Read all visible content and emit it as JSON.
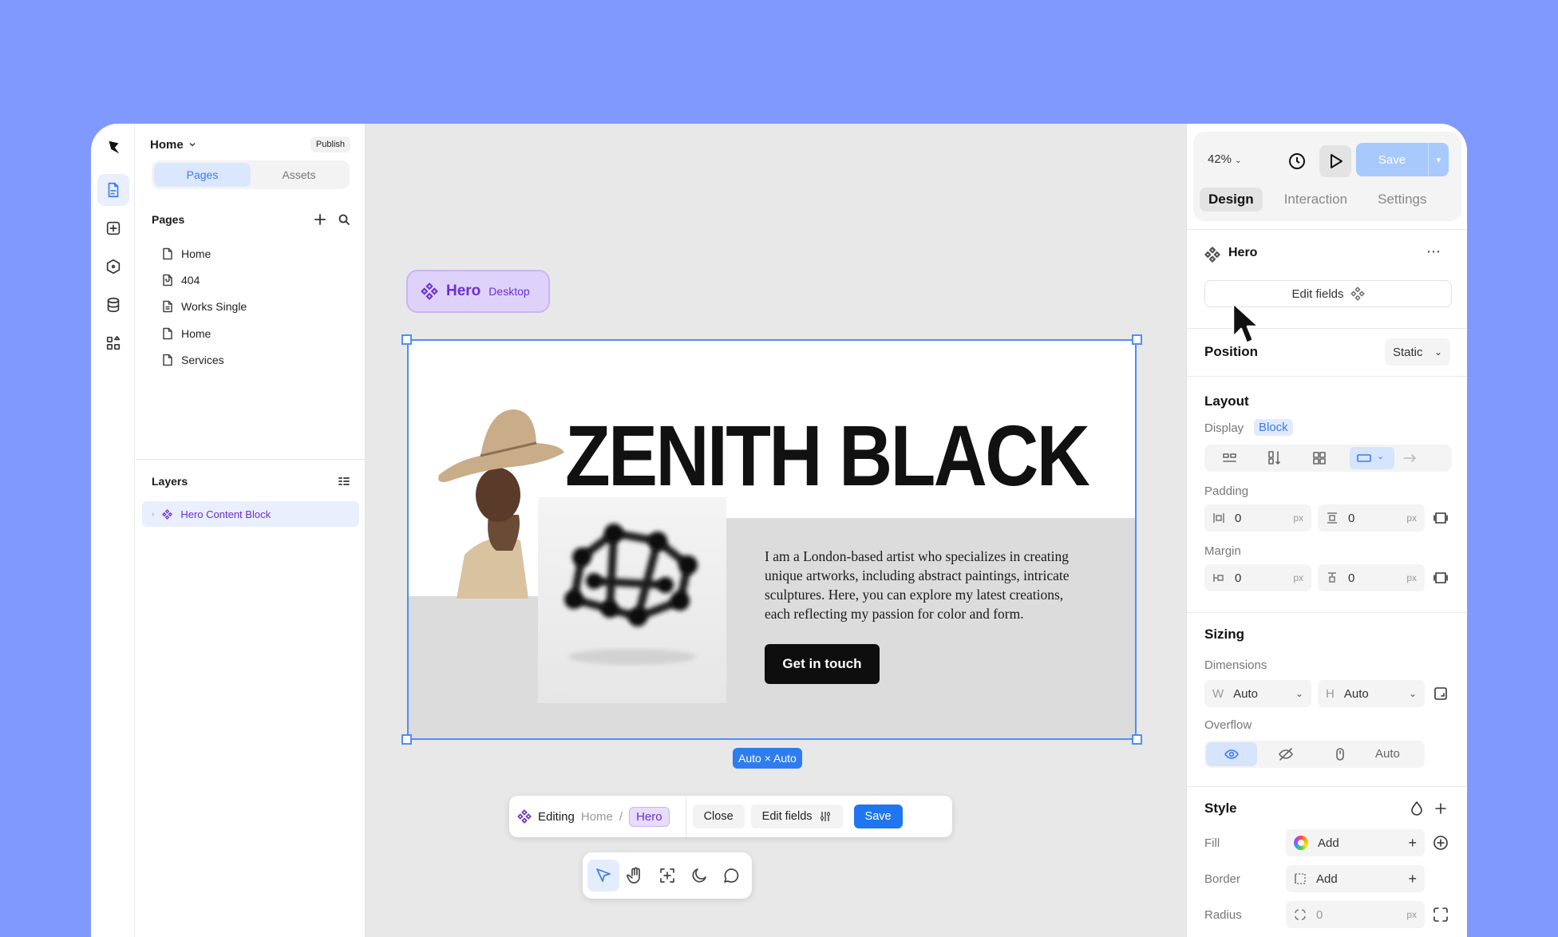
{
  "left_panel": {
    "project": "Home",
    "publish": "Publish",
    "tabs": [
      "Pages",
      "Assets"
    ],
    "pages_header": "Pages",
    "pages": [
      "Home",
      "404",
      "Works Single",
      "Home",
      "Services"
    ],
    "layers_header": "Layers",
    "layer_item": "Hero Content Block"
  },
  "canvas": {
    "chip_name": "Hero",
    "chip_mode": "Desktop",
    "hero_title": "ZENITH BLACK",
    "hero_text": "I am a London-based artist who specializes in creating unique artworks, including abstract paintings, intricate sculptures. Here, you can explore my latest creations, each reflecting my passion for color and form.",
    "cta": "Get in touch",
    "dimensions": "Auto × Auto",
    "editbar": {
      "editing": "Editing",
      "crumb": "Home",
      "sep": "/",
      "tag": "Hero",
      "close": "Close",
      "edit_fields": "Edit fields",
      "save": "Save"
    }
  },
  "right_panel": {
    "zoom": "42%",
    "save": "Save",
    "tabs": [
      "Design",
      "Interaction",
      "Settings"
    ],
    "component": "Hero",
    "edit_fields": "Edit fields",
    "position_label": "Position",
    "position_value": "Static",
    "layout": "Layout",
    "display_label": "Display",
    "display_value": "Block",
    "padding": "Padding",
    "padding_h": "0",
    "padding_v": "0",
    "margin": "Margin",
    "margin_h": "0",
    "margin_v": "0",
    "unit": "px",
    "sizing": "Sizing",
    "dimensions": "Dimensions",
    "w_label": "W",
    "w_value": "Auto",
    "h_label": "H",
    "h_value": "Auto",
    "overflow": "Overflow",
    "overflow_auto": "Auto",
    "style": "Style",
    "fill": "Fill",
    "border": "Border",
    "radius": "Radius",
    "add": "Add",
    "radius_value": "0"
  },
  "colors": {
    "background": "#8099ff",
    "accent": "#3d7bf2",
    "component_purple": "#6a2fd6"
  }
}
